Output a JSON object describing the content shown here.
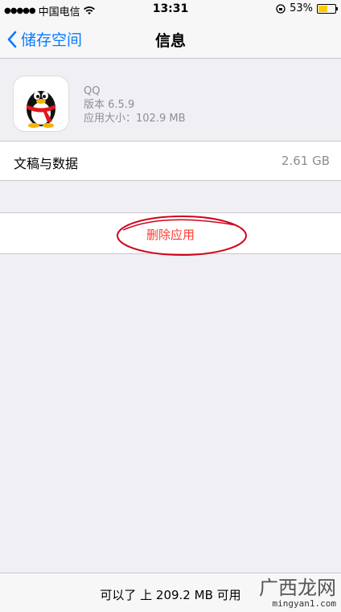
{
  "status_bar": {
    "signal_dots": "●●●●●",
    "carrier": "中国电信",
    "time": "13:31",
    "battery_percent": "53%",
    "battery_level": 0.53
  },
  "nav": {
    "back_label": "储存空间",
    "title": "信息"
  },
  "app": {
    "name": "QQ",
    "version": "版本 6.5.9",
    "size": "应用大小：102.9 MB"
  },
  "docs_data": {
    "label": "文稿与数据",
    "value": "2.61 GB"
  },
  "delete_label": "删除应用",
  "bottom": {
    "available": "可以了 上 209.2 MB 可用"
  },
  "watermark": {
    "brand": "广西龙网",
    "site": "mingyan1.com"
  },
  "colors": {
    "accent": "#0a7aff",
    "danger": "#ff3b30",
    "annotation": "#d0021b"
  }
}
